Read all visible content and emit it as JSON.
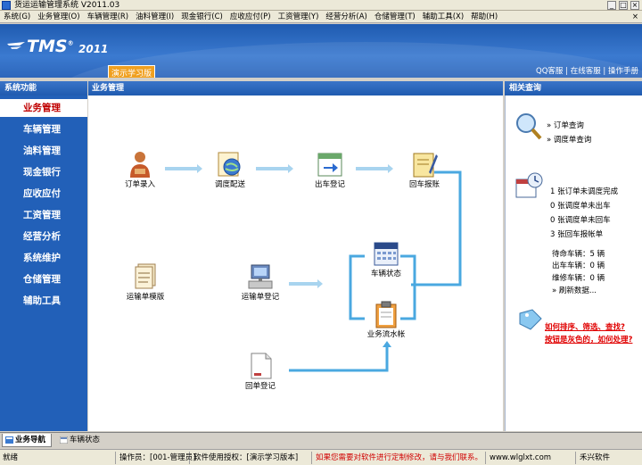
{
  "window": {
    "title": "货运运输管理系统 V2011.03",
    "minimize": "_",
    "restore": "□",
    "close": "×"
  },
  "menu": {
    "items": [
      "系统(G)",
      "业务管理(O)",
      "车辆管理(R)",
      "油料管理(I)",
      "现金银行(C)",
      "应收应付(P)",
      "工资管理(Y)",
      "经营分析(A)",
      "仓储管理(T)",
      "辅助工具(X)",
      "帮助(H)"
    ],
    "close_glyph": "×"
  },
  "banner": {
    "logo": "TMS",
    "registered": "®",
    "year": "2011",
    "edition": "演示学习版",
    "links": [
      "QQ客服",
      "在线客服",
      "操作手册"
    ],
    "separator": "|"
  },
  "sidebar": {
    "header": "系统功能",
    "items": [
      "业务管理",
      "车辆管理",
      "油料管理",
      "现金银行",
      "应收应付",
      "工资管理",
      "经营分析",
      "系统维护",
      "仓储管理",
      "辅助工具"
    ],
    "active_index": 0
  },
  "main": {
    "header": "业务管理",
    "nodes": {
      "order_entry": {
        "label": "订单录入",
        "icon": "person-icon"
      },
      "dispatch": {
        "label": "调度配送",
        "icon": "dispatch-globe-icon"
      },
      "depart": {
        "label": "出车登记",
        "icon": "calendar-arrow-icon"
      },
      "return_report": {
        "label": "回车报账",
        "icon": "notebook-pen-icon"
      },
      "waybill_template": {
        "label": "运输单模版",
        "icon": "documents-stack-icon"
      },
      "waybill_register": {
        "label": "运输单登记",
        "icon": "computer-icon"
      },
      "vehicle_status": {
        "label": "车辆状态",
        "icon": "calendar-grid-icon"
      },
      "business_ledger": {
        "label": "业务流水帐",
        "icon": "clipboard-icon"
      },
      "receipt_register": {
        "label": "回单登记",
        "icon": "paper-icon"
      }
    }
  },
  "right": {
    "header": "相关查询",
    "query_links": [
      "订单查询",
      "调度单查询"
    ],
    "bullet": "»",
    "stats": [
      {
        "count": "1",
        "text": "张订单未调度完成"
      },
      {
        "count": "0",
        "text": "张调度单未出车"
      },
      {
        "count": "0",
        "text": "张调度单未回车"
      },
      {
        "count": "3",
        "text": "张回车报帐单"
      }
    ],
    "vehicles": [
      {
        "label": "待命车辆：",
        "count": "5",
        "unit": "辆"
      },
      {
        "label": "出车车辆：",
        "count": "0",
        "unit": "辆"
      },
      {
        "label": "维修车辆：",
        "count": "0",
        "unit": "辆"
      }
    ],
    "refresh": "刷新数据...",
    "help1": "如何排序、筛选、查找?",
    "help2": "按钮是灰色的，如何处理?"
  },
  "tabs": [
    "业务导航",
    "车辆状态"
  ],
  "status": {
    "ready": "就绪",
    "operator": "操作员：[001-管理员]",
    "license": "软件使用授权：[演示学习版本]",
    "notice": "如果您需要对软件进行定制修改，请与我们联系。",
    "website": "www.wlglxt.com",
    "vendor": "禾兴软件"
  },
  "colors": {
    "accent": "#2260b8",
    "header": "#1f5bb0",
    "active_text": "#c00000",
    "arrow": "#a8d4ef",
    "connector": "#4aa8e0",
    "alert": "#e00000"
  }
}
